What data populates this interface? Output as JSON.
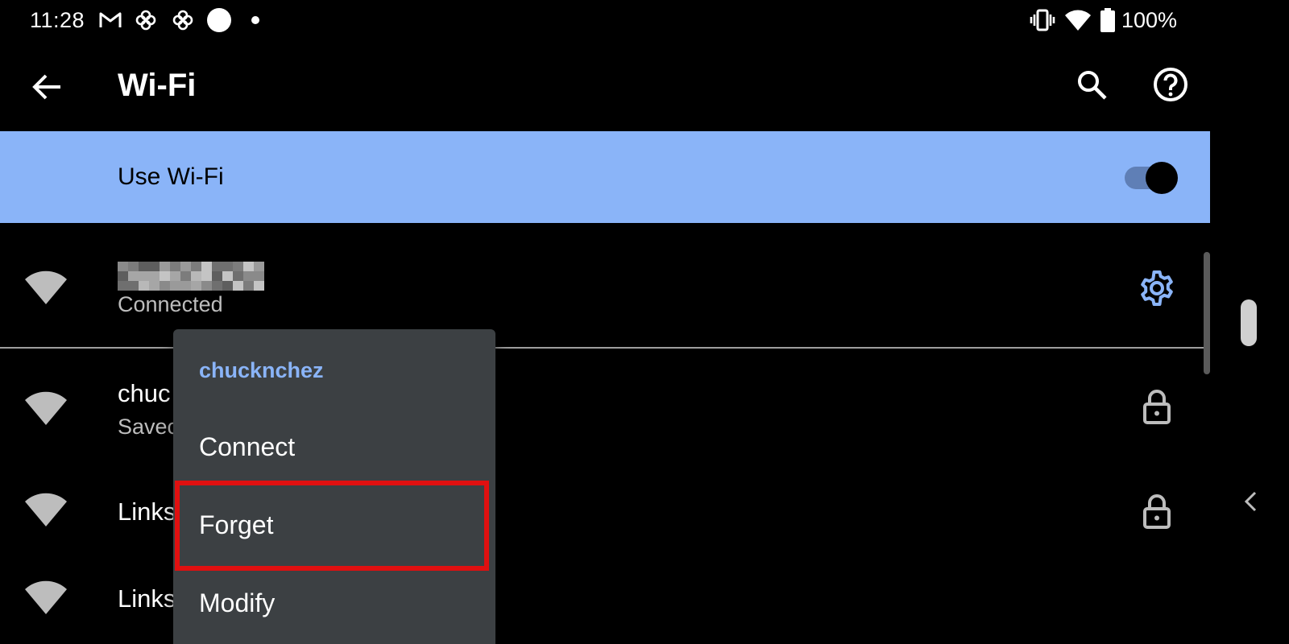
{
  "status_bar": {
    "time": "11:28",
    "battery": "100%",
    "icons": [
      "gmail-icon",
      "pinwheel-icon",
      "pinwheel-icon",
      "circle-icon",
      "dot-icon",
      "vibrate-icon",
      "wifi-icon",
      "battery-icon"
    ]
  },
  "app_bar": {
    "title": "Wi-Fi",
    "back_icon": "arrow-left-icon",
    "search_icon": "search-icon",
    "help_icon": "help-circle-icon"
  },
  "use_wifi": {
    "label": "Use Wi-Fi",
    "enabled": true,
    "bar_color": "#8ab4f8"
  },
  "networks": [
    {
      "name": "",
      "status": "Connected",
      "name_redacted": true,
      "trailing_icon": "gear-icon"
    },
    {
      "name": "chuc",
      "status": "Savec",
      "trailing_icon": "lock-icon"
    },
    {
      "name": "Links",
      "status": "",
      "trailing_icon": "lock-icon"
    },
    {
      "name": "Links",
      "status": "",
      "trailing_icon": ""
    }
  ],
  "context_menu": {
    "title": "chucknchez",
    "items": [
      {
        "label": "Connect"
      },
      {
        "label": "Forget",
        "highlighted": true
      },
      {
        "label": "Modify"
      }
    ]
  },
  "colors": {
    "accent": "#8ab4f8",
    "menu_bg": "#3c4043",
    "highlight": "#e01010"
  }
}
